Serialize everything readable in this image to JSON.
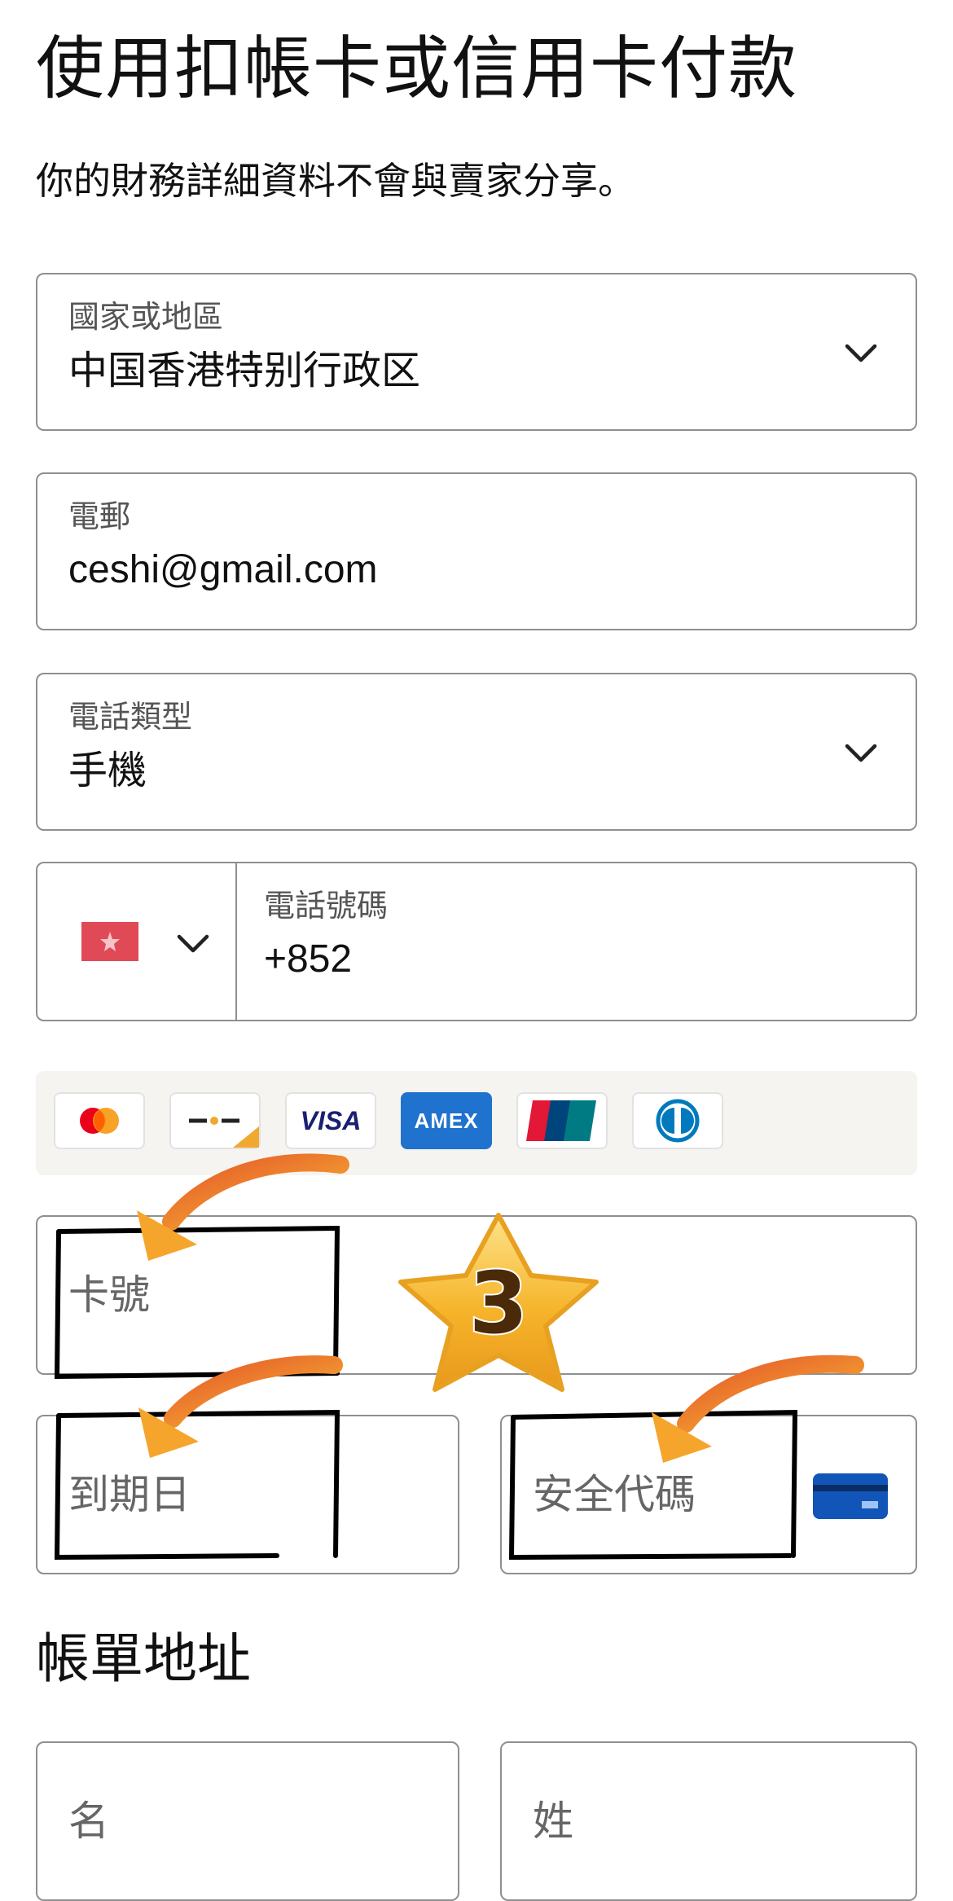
{
  "page": {
    "title": "使用扣帳卡或信用卡付款",
    "subtitle": "你的財務詳細資料不會與賣家分享。"
  },
  "form": {
    "country": {
      "label": "國家或地區",
      "value": "中国香港特别行政区"
    },
    "email": {
      "label": "電郵",
      "value": "ceshi@gmail.com"
    },
    "phone_type": {
      "label": "電話類型",
      "value": "手機"
    },
    "phone": {
      "label": "電話號碼",
      "value": "+852",
      "flag_icon": "hong-kong-flag-icon"
    },
    "card_number": {
      "placeholder": "卡號"
    },
    "expiry": {
      "placeholder": "到期日"
    },
    "cvv": {
      "placeholder": "安全代碼",
      "icon": "card-back-icon"
    }
  },
  "card_brands": [
    {
      "name": "mastercard-icon"
    },
    {
      "name": "generic-debit-icon"
    },
    {
      "name": "visa-icon",
      "text": "VISA"
    },
    {
      "name": "amex-icon",
      "text": "AMEX"
    },
    {
      "name": "unionpay-icon",
      "text": "UnionPay"
    },
    {
      "name": "diners-icon"
    }
  ],
  "billing": {
    "title": "帳單地址",
    "first_name": {
      "placeholder": "名"
    },
    "last_name": {
      "placeholder": "姓"
    }
  },
  "annotation": {
    "step_number": "3",
    "colors": {
      "star": "#f5b82e",
      "arrow": "#f08a24",
      "box": "#000000"
    }
  }
}
